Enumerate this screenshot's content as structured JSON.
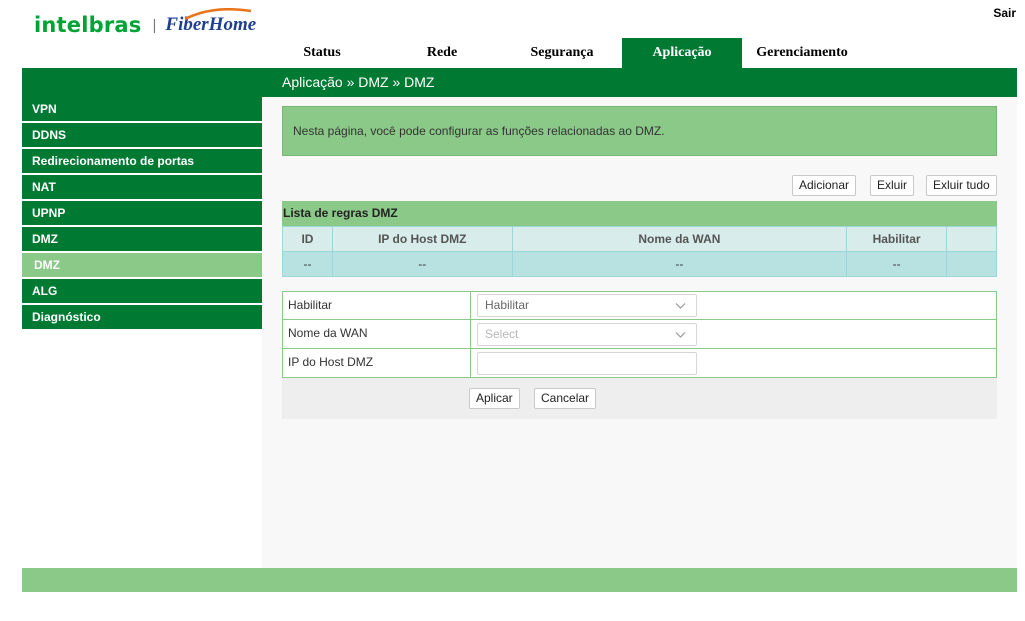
{
  "header": {
    "brand_left": "intelbras",
    "brand_separator": "|",
    "brand_right": "FiberHome",
    "logout_label": "Sair"
  },
  "topnav": {
    "tabs": [
      {
        "label": "Status"
      },
      {
        "label": "Rede"
      },
      {
        "label": "Segurança"
      },
      {
        "label": "Aplicação",
        "active": true
      },
      {
        "label": "Gerenciamento"
      }
    ]
  },
  "breadcrumb": "Aplicação » DMZ » DMZ",
  "sidebar": {
    "items": [
      {
        "label": "VPN"
      },
      {
        "label": "DDNS"
      },
      {
        "label": "Redirecionamento de portas"
      },
      {
        "label": "NAT"
      },
      {
        "label": "UPNP"
      },
      {
        "label": "DMZ"
      },
      {
        "label": "DMZ",
        "sub": true,
        "active": true
      },
      {
        "label": "ALG"
      },
      {
        "label": "Diagnóstico"
      }
    ]
  },
  "main": {
    "info_text": "Nesta página, você pode configurar as funções relacionadas ao DMZ.",
    "buttons": {
      "add": "Adicionar",
      "delete": "Exluir",
      "delete_all": "Exluir tudo"
    },
    "list_title": "Lista de regras DMZ",
    "table": {
      "headers": [
        "ID",
        "IP do Host DMZ",
        "Nome da WAN",
        "Habilitar",
        ""
      ],
      "rows": [
        [
          "--",
          "--",
          "--",
          "--",
          ""
        ]
      ]
    },
    "form": {
      "enable_label": "Habilitar",
      "enable_value": "Habilitar",
      "wan_label": "Nome da WAN",
      "wan_placeholder": "Select",
      "host_label": "IP do Host DMZ",
      "host_value": ""
    },
    "actions": {
      "apply": "Aplicar",
      "cancel": "Cancelar"
    }
  },
  "colors": {
    "primary_green": "#007a33",
    "light_green": "#8ac987",
    "table_cyan": "#b8e2e2",
    "brand_intelbras": "#00a335",
    "brand_fiberhome": "#1f3f8f"
  }
}
